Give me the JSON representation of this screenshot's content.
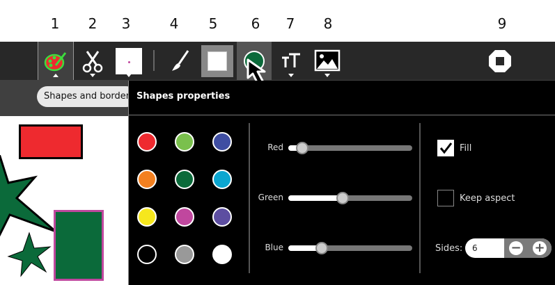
{
  "callout_numbers": [
    "1",
    "2",
    "3",
    "4",
    "5",
    "6",
    "7",
    "8",
    "9"
  ],
  "toolbar": {
    "tools": [
      {
        "name": "paint-palette-icon"
      },
      {
        "name": "scissors-icon"
      },
      {
        "name": "stamp-icon"
      },
      {
        "name": "brush-icon"
      },
      {
        "name": "rectangle-shape-icon"
      },
      {
        "name": "circle-shape-icon"
      },
      {
        "name": "text-tool-icon"
      },
      {
        "name": "image-insert-icon"
      },
      {
        "name": "stop-icon"
      }
    ]
  },
  "palette_tag": "Shapes and border",
  "panel": {
    "title": "Shapes properties",
    "swatch_colors": [
      "#ee2a2f",
      "#7ac04d",
      "#3f4ea2",
      "#f38020",
      "#0b6a3a",
      "#0ba6d0",
      "#f6e71d",
      "#c0479e",
      "#5d4ea1",
      "#000000",
      "#999999",
      "#ffffff"
    ],
    "sliders": [
      {
        "label": "Red",
        "value": 0.11
      },
      {
        "label": "Green",
        "value": 0.44
      },
      {
        "label": "Blue",
        "value": 0.27
      }
    ],
    "fill_label": "Fill",
    "fill_checked": true,
    "keep_aspect_label": "Keep aspect",
    "keep_aspect_checked": false,
    "sides_label": "Sides:",
    "sides_value": "6"
  },
  "canvas_colors": {
    "red_rect": "#ee2a2f",
    "green": "#0b6a3a",
    "magenta_border": "#c0479e"
  }
}
